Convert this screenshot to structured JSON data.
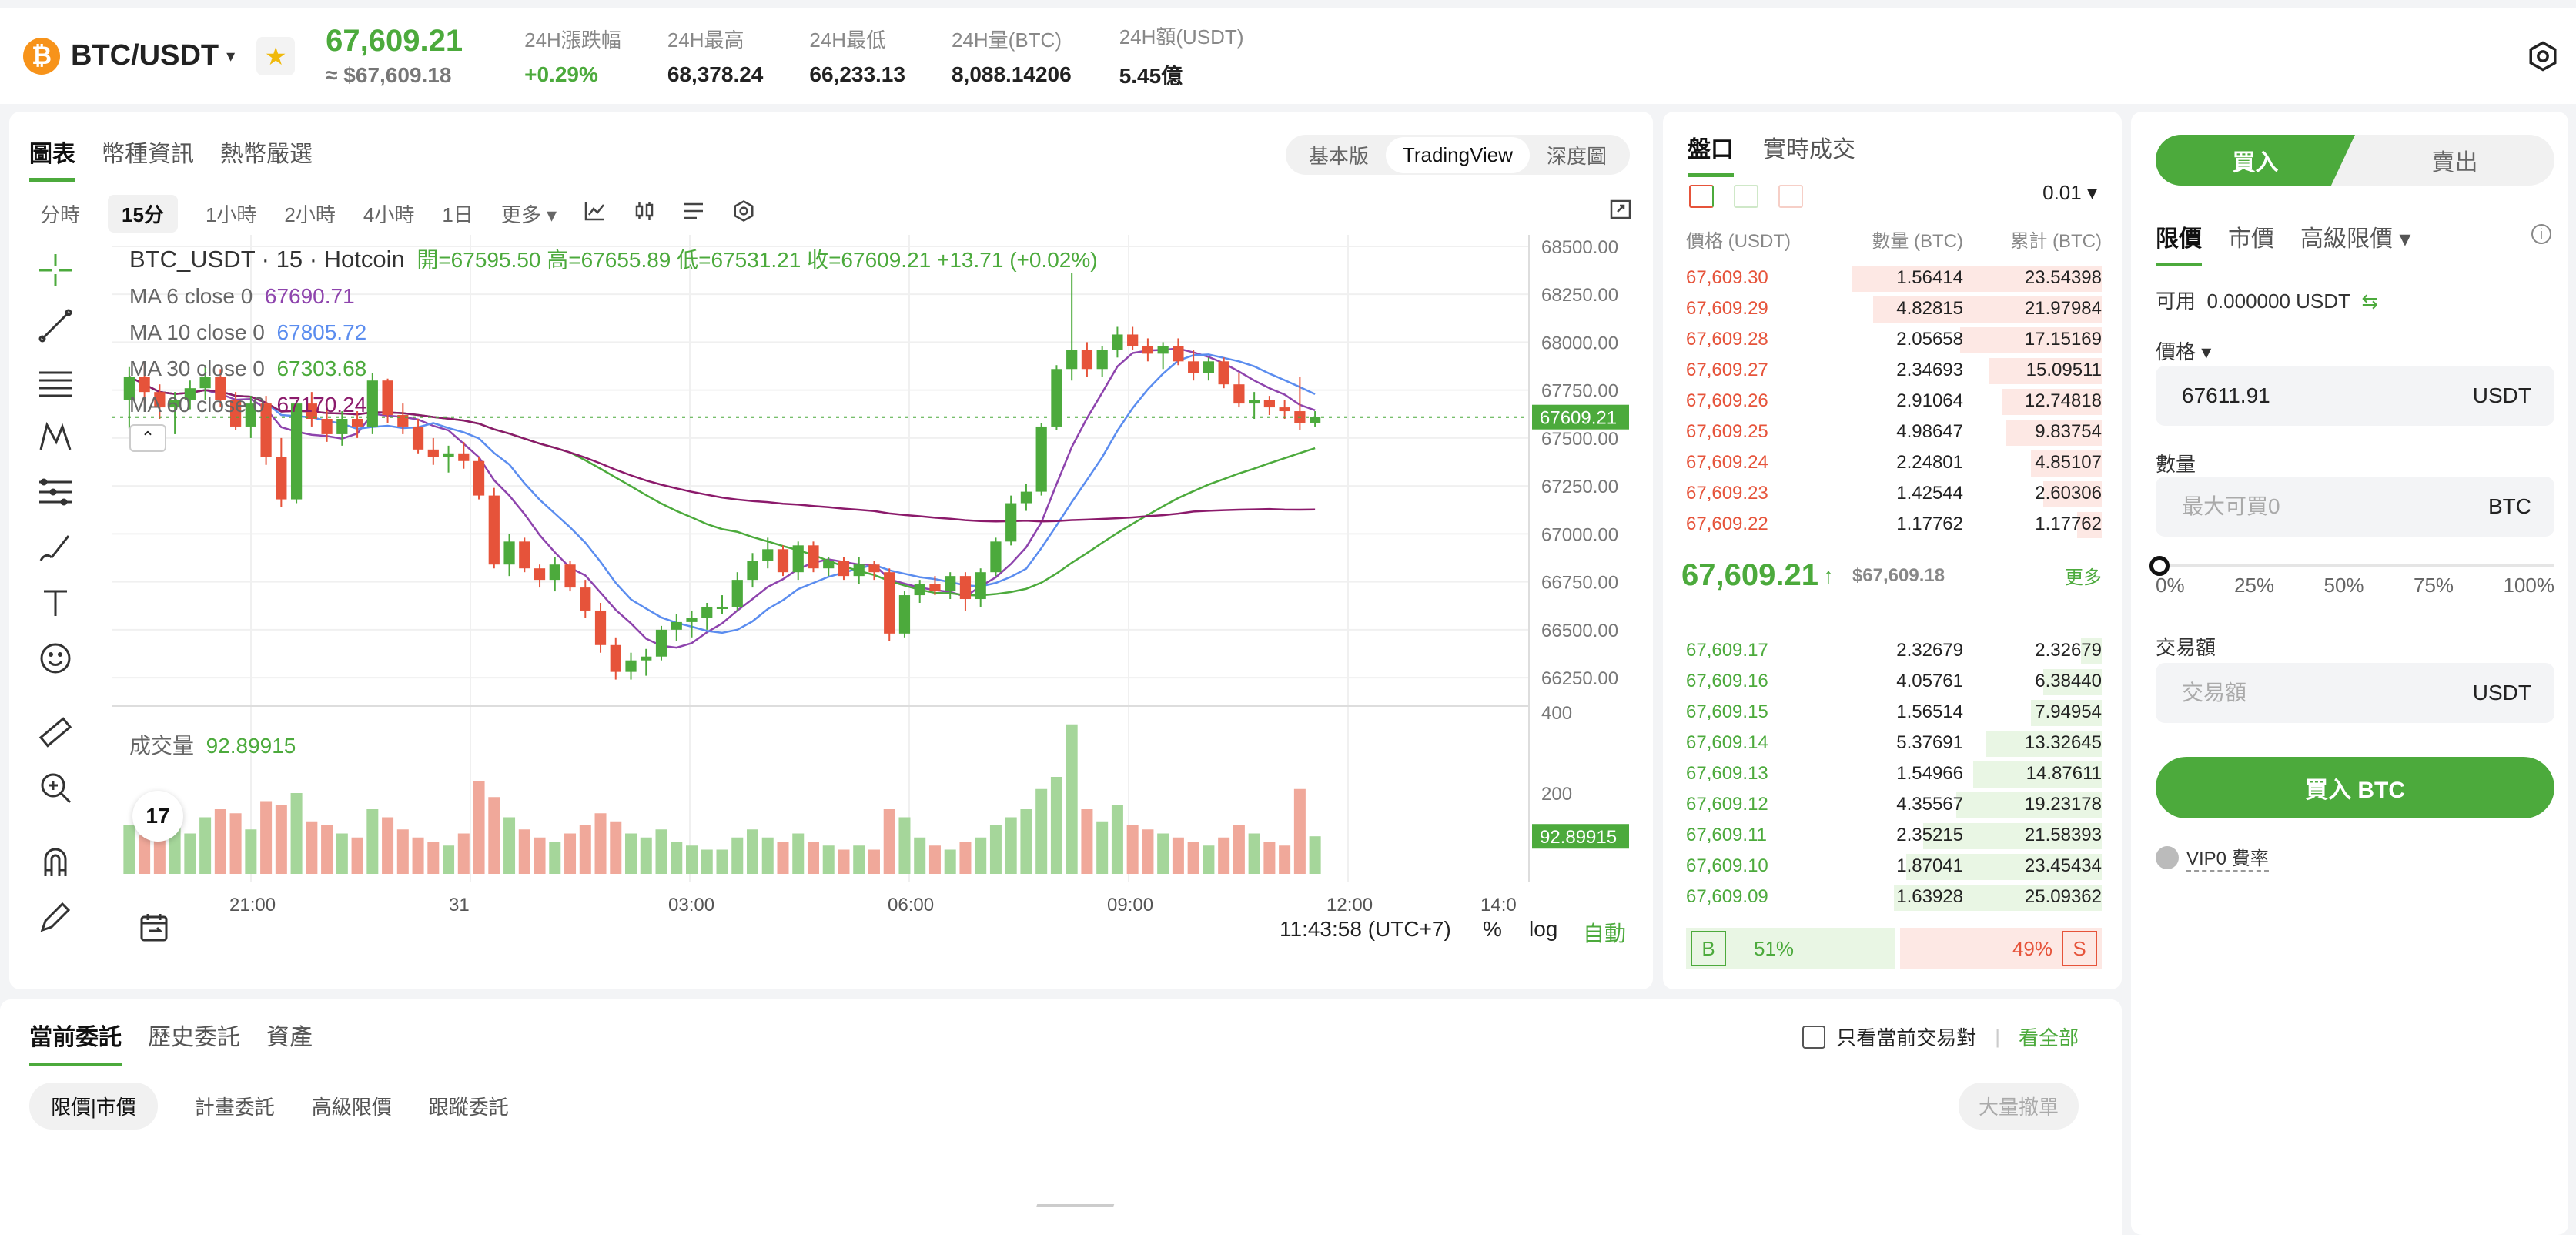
{
  "header": {
    "symbol_logo": "₿",
    "pair": "BTC/USDT",
    "price": "67,609.21",
    "price_usd": "≈ $67,609.18",
    "stats": [
      {
        "label": "24H漲跌幅",
        "value": "+0.29%",
        "green": true
      },
      {
        "label": "24H最高",
        "value": "68,378.24"
      },
      {
        "label": "24H最低",
        "value": "66,233.13"
      },
      {
        "label": "24H量(BTC)",
        "value": "8,088.14206"
      },
      {
        "label": "24H額(USDT)",
        "value": "5.45億"
      }
    ]
  },
  "chart_panel": {
    "tabs": [
      "圖表",
      "幣種資訊",
      "熱幣嚴選"
    ],
    "views": [
      "基本版",
      "TradingView",
      "深度圖"
    ],
    "timeframes": [
      "分時",
      "15分",
      "1小時",
      "2小時",
      "4小時",
      "1日",
      "更多"
    ],
    "legend": {
      "title_name": "BTC_USDT · 15 · Hotcoin",
      "ohlc": "開=67595.50  高=67655.89  低=67531.21  收=67609.21  +13.71 (+0.02%)",
      "ma6_label": "MA 6 close 0",
      "ma6_value": "67690.71",
      "ma10_label": "MA 10 close 0",
      "ma10_value": "67805.72",
      "ma30_label": "MA 30 close 0",
      "ma30_value": "67303.68",
      "ma60_label": "MA 60 close 0",
      "ma60_value": "67170.24",
      "vol_label": "成交量",
      "vol_value": "92.89915"
    },
    "footer": {
      "time": "11:43:58 (UTC+7)",
      "pct": "%",
      "log": "log",
      "auto": "自動"
    }
  },
  "chart_data": {
    "type": "candlestick",
    "y_ticks": [
      68500,
      68250,
      68000,
      67750,
      67500,
      67250,
      67000,
      66750,
      66500,
      66250
    ],
    "y_range": [
      66150,
      68560
    ],
    "vol_ticks": [
      400,
      200
    ],
    "vol_range": [
      0,
      400
    ],
    "x_labels": [
      "21:00",
      "31",
      "03:00",
      "06:00",
      "09:00",
      "12:00",
      "14:0"
    ],
    "last_price": "67609.21",
    "last_volume": "92.89915",
    "candles": [
      [
        67700,
        67870,
        67550,
        67820,
        120
      ],
      [
        67820,
        67900,
        67680,
        67740,
        95
      ],
      [
        67740,
        67780,
        67600,
        67660,
        110
      ],
      [
        67660,
        67740,
        67520,
        67700,
        130
      ],
      [
        67700,
        67800,
        67650,
        67760,
        100
      ],
      [
        67760,
        67880,
        67700,
        67820,
        140
      ],
      [
        67820,
        67860,
        67660,
        67700,
        160
      ],
      [
        67700,
        67740,
        67540,
        67560,
        150
      ],
      [
        67560,
        67720,
        67500,
        67680,
        110
      ],
      [
        67680,
        67720,
        67360,
        67400,
        180
      ],
      [
        67400,
        67500,
        67140,
        67180,
        170
      ],
      [
        67180,
        67700,
        67160,
        67680,
        200
      ],
      [
        67680,
        67740,
        67560,
        67600,
        130
      ],
      [
        67600,
        67700,
        67480,
        67520,
        120
      ],
      [
        67520,
        67640,
        67460,
        67600,
        100
      ],
      [
        67600,
        67640,
        67500,
        67560,
        90
      ],
      [
        67560,
        67840,
        67520,
        67800,
        160
      ],
      [
        67800,
        67810,
        67580,
        67620,
        140
      ],
      [
        67620,
        67680,
        67520,
        67560,
        110
      ],
      [
        67560,
        67600,
        67420,
        67440,
        90
      ],
      [
        67440,
        67500,
        67360,
        67400,
        80
      ],
      [
        67400,
        67460,
        67320,
        67420,
        70
      ],
      [
        67420,
        67480,
        67340,
        67380,
        100
      ],
      [
        67380,
        67400,
        67180,
        67200,
        230
      ],
      [
        67200,
        67240,
        66820,
        66840,
        190
      ],
      [
        66840,
        67000,
        66780,
        66960,
        140
      ],
      [
        66960,
        66980,
        66800,
        66820,
        110
      ],
      [
        66820,
        66840,
        66720,
        66760,
        90
      ],
      [
        66760,
        66880,
        66700,
        66840,
        80
      ],
      [
        66840,
        66860,
        66700,
        66720,
        100
      ],
      [
        66720,
        66760,
        66560,
        66600,
        120
      ],
      [
        66600,
        66640,
        66380,
        66420,
        150
      ],
      [
        66420,
        66460,
        66240,
        66280,
        130
      ],
      [
        66280,
        66380,
        66240,
        66340,
        100
      ],
      [
        66340,
        66400,
        66260,
        66360,
        90
      ],
      [
        66360,
        66520,
        66340,
        66500,
        110
      ],
      [
        66500,
        66580,
        66440,
        66540,
        80
      ],
      [
        66540,
        66600,
        66460,
        66560,
        70
      ],
      [
        66560,
        66640,
        66500,
        66620,
        60
      ],
      [
        66620,
        66680,
        66580,
        66620,
        60
      ],
      [
        66620,
        66800,
        66600,
        66760,
        90
      ],
      [
        66760,
        66900,
        66720,
        66860,
        110
      ],
      [
        66860,
        66980,
        66820,
        66920,
        90
      ],
      [
        66920,
        66940,
        66780,
        66800,
        80
      ],
      [
        66800,
        66960,
        66760,
        66940,
        100
      ],
      [
        66940,
        66960,
        66800,
        66820,
        80
      ],
      [
        66820,
        66880,
        66780,
        66860,
        70
      ],
      [
        66860,
        66880,
        66760,
        66780,
        60
      ],
      [
        66780,
        66880,
        66740,
        66840,
        70
      ],
      [
        66840,
        66860,
        66760,
        66800,
        60
      ],
      [
        66800,
        66820,
        66440,
        66480,
        160
      ],
      [
        66480,
        66700,
        66460,
        66680,
        140
      ],
      [
        66680,
        66760,
        66640,
        66740,
        90
      ],
      [
        66740,
        66780,
        66680,
        66700,
        70
      ],
      [
        66700,
        66800,
        66660,
        66780,
        60
      ],
      [
        66780,
        66800,
        66600,
        66660,
        80
      ],
      [
        66660,
        66820,
        66620,
        66800,
        90
      ],
      [
        66800,
        66980,
        66780,
        66960,
        120
      ],
      [
        66960,
        67200,
        66940,
        67160,
        140
      ],
      [
        67160,
        67260,
        67120,
        67220,
        160
      ],
      [
        67220,
        67580,
        67200,
        67560,
        210
      ],
      [
        67560,
        67880,
        67540,
        67860,
        240
      ],
      [
        67860,
        68360,
        67800,
        67960,
        370
      ],
      [
        67960,
        68000,
        67820,
        67860,
        160
      ],
      [
        67860,
        67980,
        67820,
        67960,
        130
      ],
      [
        67960,
        68080,
        67920,
        68040,
        170
      ],
      [
        68040,
        68080,
        67960,
        67980,
        120
      ],
      [
        67980,
        68020,
        67900,
        67940,
        110
      ],
      [
        67940,
        68000,
        67860,
        67980,
        100
      ],
      [
        67980,
        68020,
        67880,
        67900,
        90
      ],
      [
        67900,
        67960,
        67800,
        67840,
        80
      ],
      [
        67840,
        67920,
        67800,
        67900,
        70
      ],
      [
        67900,
        67920,
        67760,
        67780,
        90
      ],
      [
        67780,
        67840,
        67660,
        67680,
        120
      ],
      [
        67680,
        67740,
        67600,
        67700,
        100
      ],
      [
        67700,
        67720,
        67620,
        67660,
        80
      ],
      [
        67660,
        67700,
        67600,
        67640,
        70
      ],
      [
        67640,
        67820,
        67540,
        67580,
        210
      ],
      [
        67580,
        67640,
        67560,
        67609,
        93
      ]
    ]
  },
  "orderbook": {
    "tabs": [
      "盤口",
      "實時成交"
    ],
    "precision": "0.01",
    "headers": [
      "價格 (USDT)",
      "數量 (BTC)",
      "累計 (BTC)"
    ],
    "asks": [
      [
        "67,609.30",
        "1.56414",
        "23.54398"
      ],
      [
        "67,609.29",
        "4.82815",
        "21.97984"
      ],
      [
        "67,609.28",
        "2.05658",
        "17.15169"
      ],
      [
        "67,609.27",
        "2.34693",
        "15.09511"
      ],
      [
        "67,609.26",
        "2.91064",
        "12.74818"
      ],
      [
        "67,609.25",
        "4.98647",
        "9.83754"
      ],
      [
        "67,609.24",
        "2.24801",
        "4.85107"
      ],
      [
        "67,609.23",
        "1.42544",
        "2.60306"
      ],
      [
        "67,609.22",
        "1.17762",
        "1.17762"
      ]
    ],
    "ask_depth": [
      0.6,
      0.55,
      0.34,
      0.27,
      0.24,
      0.23,
      0.17,
      0.14,
      0.06
    ],
    "mid_price": "67,609.21",
    "mid_usd": "$67,609.18",
    "more": "更多",
    "bids": [
      [
        "67,609.17",
        "2.32679",
        "2.32679"
      ],
      [
        "67,609.16",
        "4.05761",
        "6.38440"
      ],
      [
        "67,609.15",
        "1.56514",
        "7.94954"
      ],
      [
        "67,609.14",
        "5.37691",
        "13.32645"
      ],
      [
        "67,609.13",
        "1.54966",
        "14.87611"
      ],
      [
        "67,609.12",
        "4.35567",
        "19.23178"
      ],
      [
        "67,609.11",
        "2.35215",
        "21.58393"
      ],
      [
        "67,609.10",
        "1.87041",
        "23.45434"
      ],
      [
        "67,609.09",
        "1.63928",
        "25.09362"
      ]
    ],
    "bid_depth": [
      0.05,
      0.14,
      0.17,
      0.28,
      0.31,
      0.35,
      0.43,
      0.47,
      0.5
    ],
    "buy_ratio": "51%",
    "sell_ratio": "49%",
    "b": "B",
    "s": "S"
  },
  "trade": {
    "buy": "買入",
    "sell": "賣出",
    "order_types": [
      "限價",
      "市價",
      "高級限價"
    ],
    "available_label": "可用",
    "available_value": "0.000000 USDT",
    "price_label": "價格",
    "price_value": "67611.91",
    "usdt": "USDT",
    "amount_label": "數量",
    "amount_placeholder": "最大可買0",
    "btc": "BTC",
    "percentages": [
      "0%",
      "25%",
      "50%",
      "75%",
      "100%"
    ],
    "total_label": "交易額",
    "total_placeholder": "交易額",
    "buy_button": "買入 BTC",
    "vip": "VIP0 費率"
  },
  "orders": {
    "tabs": [
      "當前委託",
      "歷史委託",
      "資產"
    ],
    "subtabs": [
      "限價|市價",
      "計畫委託",
      "高級限價",
      "跟蹤委託"
    ],
    "only_current": "只看當前交易對",
    "view_all": "看全部",
    "cancel_all": "大量撤單"
  },
  "colors": {
    "up": "#4caa3c",
    "down": "#e6533a",
    "ma6": "#8e44ad",
    "ma10": "#5b8def",
    "ma30": "#4caa3c",
    "ma60": "#8b1a6b"
  }
}
